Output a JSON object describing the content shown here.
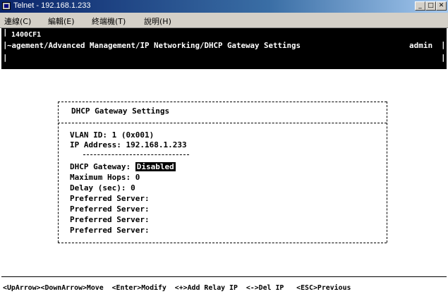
{
  "window": {
    "title": "Telnet - 192.168.1.233"
  },
  "menu": [
    "連線(C)",
    "編輯(E)",
    "終端機(T)",
    "說明(H)"
  ],
  "header": {
    "device": "1400CF1",
    "path": "~agement/Advanced Management/IP Networking/DHCP Gateway Settings",
    "user": "admin"
  },
  "panel": {
    "title": "DHCP Gateway Settings",
    "vlan": "VLAN ID: 1 (0x001)",
    "ip": "IP Address: 192.168.1.233",
    "gateway_label": "DHCP Gateway: ",
    "gateway_value": "Disabled",
    "hops": "Maximum Hops: 0",
    "delay": "Delay (sec): 0",
    "servers": [
      "Preferred Server:",
      "Preferred Server:",
      "Preferred Server:",
      "Preferred Server:"
    ]
  },
  "footer": "<UpArrow><DownArrow>Move  <Enter>Modify  <+>Add Relay IP  <->Del IP   <ESC>Previous"
}
